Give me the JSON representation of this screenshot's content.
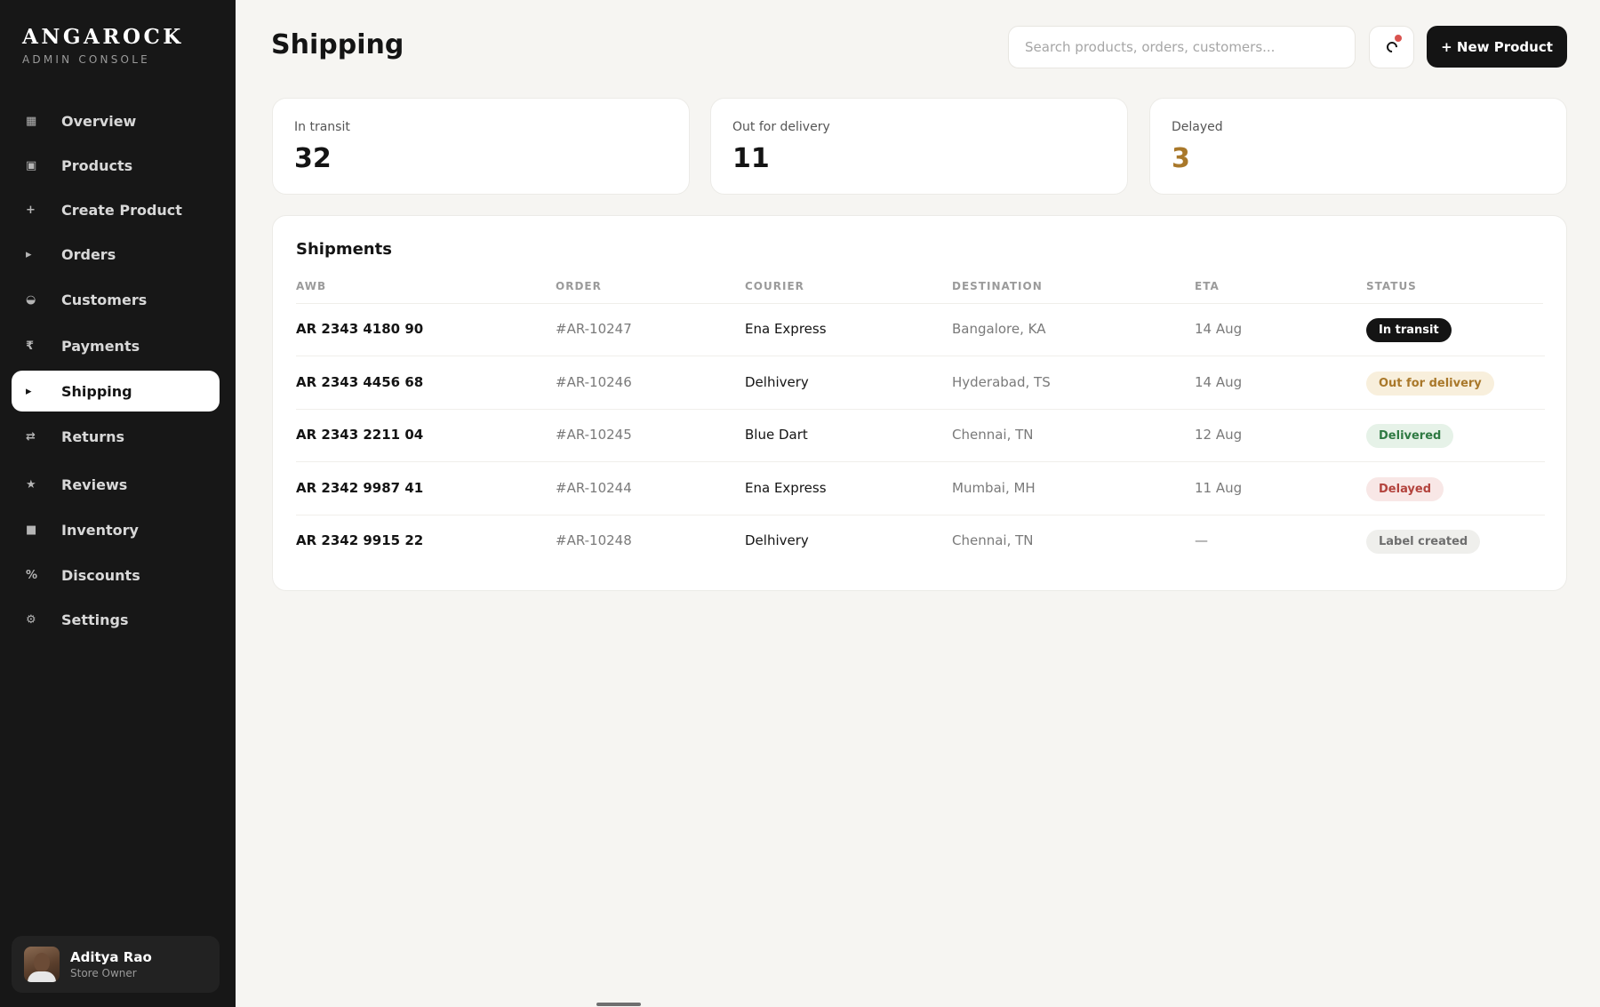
{
  "brand": {
    "name": "ANGAROCK",
    "subtitle": "ADMIN CONSOLE"
  },
  "sidebar": {
    "items": [
      {
        "label": "Overview",
        "icon": "▦",
        "icon_name": "overview-icon"
      },
      {
        "label": "Products",
        "icon": "▣",
        "icon_name": "products-icon"
      },
      {
        "label": "Create Product",
        "icon": "+",
        "icon_name": "plus-icon"
      },
      {
        "label": "Orders",
        "icon": "▸",
        "icon_name": "orders-icon"
      },
      {
        "label": "Customers",
        "icon": "◒",
        "icon_name": "customers-icon"
      },
      {
        "label": "Payments",
        "icon": "₹",
        "icon_name": "rupee-icon"
      },
      {
        "label": "Shipping",
        "icon": "▸",
        "icon_name": "shipping-icon",
        "active": true
      },
      {
        "label": "Returns",
        "icon": "⇄",
        "icon_name": "returns-icon"
      },
      {
        "label": "Reviews",
        "icon": "★",
        "icon_name": "star-icon"
      },
      {
        "label": "Inventory",
        "icon": "■",
        "icon_name": "inventory-icon"
      },
      {
        "label": "Discounts",
        "icon": "%",
        "icon_name": "percent-icon"
      },
      {
        "label": "Settings",
        "icon": "⚙",
        "icon_name": "gear-icon"
      }
    ]
  },
  "user": {
    "name": "Aditya Rao",
    "role": "Store Owner"
  },
  "header": {
    "title": "Shipping",
    "search_placeholder": "Search products, orders, customers...",
    "new_button_label": "+ New Product"
  },
  "stats": [
    {
      "label": "In transit",
      "value": "32"
    },
    {
      "label": "Out for delivery",
      "value": "11"
    },
    {
      "label": "Delayed",
      "value": "3",
      "accent": "#a9782a"
    }
  ],
  "shipments": {
    "title": "Shipments",
    "columns": [
      "AWB",
      "ORDER",
      "COURIER",
      "DESTINATION",
      "ETA",
      "STATUS"
    ],
    "rows": [
      {
        "awb": "AR 2343 4180 90",
        "order": "#AR-10247",
        "courier": "Ena Express",
        "destination": "Bangalore, KA",
        "eta": "14 Aug",
        "status": "In transit",
        "status_kind": "transit"
      },
      {
        "awb": "AR 2343 4456 68",
        "order": "#AR-10246",
        "courier": "Delhivery",
        "destination": "Hyderabad, TS",
        "eta": "14 Aug",
        "status": "Out for delivery",
        "status_kind": "outdel"
      },
      {
        "awb": "AR 2343 2211 04",
        "order": "#AR-10245",
        "courier": "Blue Dart",
        "destination": "Chennai, TN",
        "eta": "12 Aug",
        "status": "Delivered",
        "status_kind": "delivered"
      },
      {
        "awb": "AR 2342 9987 41",
        "order": "#AR-10244",
        "courier": "Ena Express",
        "destination": "Mumbai, MH",
        "eta": "11 Aug",
        "status": "Delayed",
        "status_kind": "delayed"
      },
      {
        "awb": "AR 2342 9915 22",
        "order": "#AR-10248",
        "courier": "Delhivery",
        "destination": "Chennai, TN",
        "eta": "—",
        "status": "Label created",
        "status_kind": "label"
      }
    ]
  },
  "colors": {
    "sidebar_bg": "#171717",
    "accent_dark": "#141414",
    "warning": "#a9782a",
    "success": "#2f7a43",
    "danger": "#b3433d",
    "notification_dot": "#d9534f"
  }
}
